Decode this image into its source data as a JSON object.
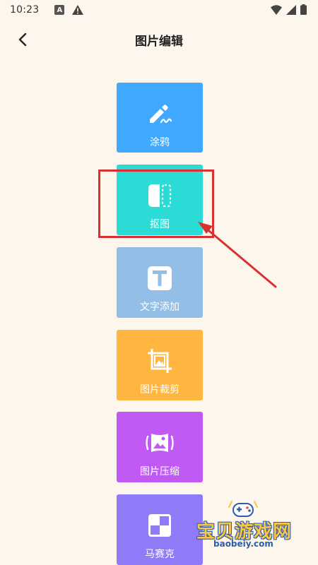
{
  "status_bar": {
    "time": "10:23",
    "a_icon_letter": "A"
  },
  "header": {
    "title": "图片编辑"
  },
  "tools": [
    {
      "label": "涂鸦",
      "icon": "pen-icon",
      "color": "#40A9FF"
    },
    {
      "label": "抠图",
      "icon": "cutout-icon",
      "color": "#2BDCD6"
    },
    {
      "label": "文字添加",
      "icon": "text-t-icon",
      "color": "#93BFE6"
    },
    {
      "label": "图片裁剪",
      "icon": "crop-icon",
      "color": "#FFB640"
    },
    {
      "label": "图片压缩",
      "icon": "compress-icon",
      "color": "#C159F5"
    },
    {
      "label": "马赛克",
      "icon": "mosaic-icon",
      "color": "#8F7BF7"
    }
  ],
  "annotation": {
    "color": "#D93030"
  },
  "watermark": {
    "name": "宝贝游戏网",
    "url": "baobeiy.com"
  }
}
